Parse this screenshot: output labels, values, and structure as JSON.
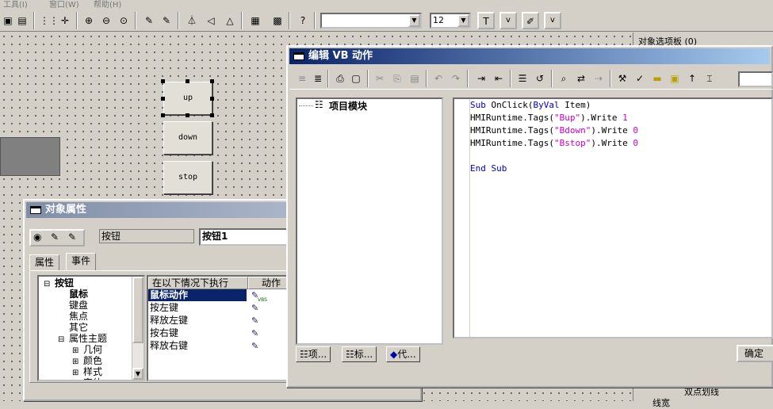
{
  "menubar": {
    "items": [
      "工具(I)",
      "窗口(W)",
      "帮助(H)"
    ]
  },
  "toolbar": {
    "font_combo": "",
    "size_combo": "12",
    "btn_v1": "v",
    "btn_v2": "v"
  },
  "canvas_buttons": {
    "up": "up",
    "down": "down",
    "stop": "stop"
  },
  "right_panel": {
    "title": "对象选项板 (0)",
    "tree_item": "双点划线",
    "tree_item2": "线宽"
  },
  "props": {
    "title": "对象属性",
    "type_value": "按钮",
    "name_value": "按钮1",
    "tabs": [
      "属性",
      "事件"
    ],
    "tree": [
      {
        "label": "按钮",
        "indent": 0,
        "toggle": "⊟",
        "bold": true
      },
      {
        "label": "鼠标",
        "indent": 1,
        "toggle": "",
        "bold": true
      },
      {
        "label": "键盘",
        "indent": 1,
        "toggle": "",
        "bold": false
      },
      {
        "label": "焦点",
        "indent": 1,
        "toggle": "",
        "bold": false
      },
      {
        "label": "其它",
        "indent": 1,
        "toggle": "",
        "bold": false
      },
      {
        "label": "属性主题",
        "indent": 1,
        "toggle": "⊟",
        "bold": false
      },
      {
        "label": "几何",
        "indent": 2,
        "toggle": "⊞",
        "bold": false
      },
      {
        "label": "颜色",
        "indent": 2,
        "toggle": "⊞",
        "bold": false
      },
      {
        "label": "样式",
        "indent": 2,
        "toggle": "⊞",
        "bold": false
      },
      {
        "label": "字体",
        "indent": 2,
        "toggle": "⊞",
        "bold": false
      }
    ],
    "events_header": {
      "col1": "在以下情况下执行",
      "col2": "动作"
    },
    "events": [
      {
        "label": "鼠标动作",
        "selected": true,
        "icon": "VBS"
      },
      {
        "label": "按左键",
        "selected": false,
        "icon": ""
      },
      {
        "label": "释放左键",
        "selected": false,
        "icon": ""
      },
      {
        "label": "按右键",
        "selected": false,
        "icon": ""
      },
      {
        "label": "释放右键",
        "selected": false,
        "icon": ""
      }
    ]
  },
  "vb": {
    "title": "编辑 VB 动作",
    "module_label": "项目模块",
    "bottom_tabs": [
      "项...",
      "标...",
      "代..."
    ],
    "ok_button": "确定",
    "code": [
      [
        {
          "t": "Sub",
          "c": "kw"
        },
        {
          "t": " OnClick(",
          "c": ""
        },
        {
          "t": "ByVal",
          "c": "kw"
        },
        {
          "t": " Item)",
          "c": ""
        }
      ],
      [
        {
          "t": "HMIRuntime.Tags(",
          "c": ""
        },
        {
          "t": "\"Bup\"",
          "c": "str"
        },
        {
          "t": ").Write ",
          "c": ""
        },
        {
          "t": "1",
          "c": "num"
        }
      ],
      [
        {
          "t": "HMIRuntime.Tags(",
          "c": ""
        },
        {
          "t": "\"Bdown\"",
          "c": "str"
        },
        {
          "t": ").Write ",
          "c": ""
        },
        {
          "t": "0",
          "c": "num"
        }
      ],
      [
        {
          "t": "HMIRuntime.Tags(",
          "c": ""
        },
        {
          "t": "\"Bstop\"",
          "c": "str"
        },
        {
          "t": ").Write ",
          "c": ""
        },
        {
          "t": "0",
          "c": "num"
        }
      ],
      [],
      [
        {
          "t": "End Sub",
          "c": "kw"
        }
      ]
    ]
  }
}
